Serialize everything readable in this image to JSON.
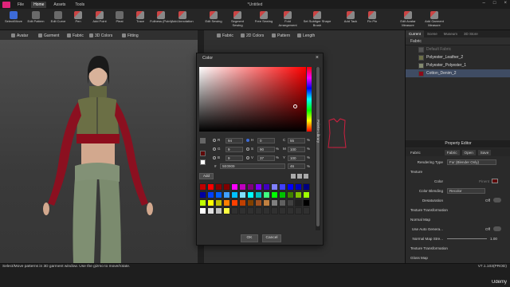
{
  "menubar": {
    "items": [
      "File",
      "Home",
      "Assets",
      "Tools"
    ],
    "title": "*Untitled"
  },
  "toolbar": {
    "tools": [
      "Select/Move",
      "Edit Pattern",
      "Edit Curve",
      "Pen",
      "Add Point",
      "Pleat",
      "Trace",
      "Fullness (Point)",
      "Add Annotation",
      "Edit Sewing",
      "Segment Sewing",
      "Free Sewing",
      "Fold Arrangement",
      "Set Subtiger Shape Brush",
      "Add Tack",
      "Fix Pin",
      "Edit Avatar Measure",
      "Add Garment Measure"
    ]
  },
  "view3d_tabs": [
    "Avatar",
    "Garment",
    "Fabric",
    "3D Colors",
    "Fitting"
  ],
  "view2d_tabs": [
    "Fabric",
    "2D Colors",
    "Pattern",
    "Length"
  ],
  "right_tabs": [
    "Current",
    "Scene",
    "Museum",
    "3D Store"
  ],
  "fabric_list": {
    "header": "Fabric",
    "items": [
      {
        "label": "Default Fabric",
        "color": "#555555",
        "state": "dim"
      },
      {
        "label": "Polyester_Leather_2",
        "color": "#6d7048",
        "state": "normal"
      },
      {
        "label": "Polyester_Polyester_1",
        "color": "#848b70",
        "state": "normal"
      },
      {
        "label": "Cotton_Denim_2",
        "color": "#8b0a1a",
        "state": "selected"
      }
    ]
  },
  "property_editor": {
    "title": "Property Editor",
    "header": "Fabric",
    "header_btns": [
      "Fabric",
      "Open",
      "Save"
    ],
    "rendering_type_label": "Rendering Type",
    "rendering_type_value": "Fur (Blender Only)",
    "texture_label": "Texture",
    "color_label": "Color",
    "color_value": "Pinent",
    "color_blending_label": "Color Blending",
    "color_blending_value": "Recolor",
    "desaturation_label": "Desaturation",
    "desaturation_value": "Off",
    "texture_transformation": "Texture Transformation",
    "normal_map_label": "Normal Map",
    "use_auto_label": "Use Auto Genera...",
    "use_auto_value": "Off",
    "normal_map_strength_label": "Normal Map Stre...",
    "normal_map_strength_value": "1.00",
    "texture_transformation2": "Texture Transformation",
    "gloss_map_label": "Gloss Map"
  },
  "color_dialog": {
    "title": "Color",
    "close": "×",
    "fields": {
      "R": "94",
      "G": "9",
      "B": "9",
      "H": "0",
      "S": "90",
      "V": "37",
      "C": "55",
      "M": "100",
      "Y": "100",
      "K": "46"
    },
    "percent": "%",
    "hash": "#",
    "hex": "5E0909",
    "add_label": "Add",
    "side_label": "Palette Library",
    "ok": "OK",
    "cancel": "Cancel",
    "current_color": "#5e0909",
    "palette": [
      "#c00000",
      "#ff0000",
      "#8b0000",
      "#800000",
      "#ff00ff",
      "#c000c0",
      "#800080",
      "#8000ff",
      "#4000c0",
      "#8080ff",
      "#4040ff",
      "#0000ff",
      "#0000c0",
      "#000080",
      "#0000a0",
      "#0040ff",
      "#0060ff",
      "#40a0ff",
      "#00c0ff",
      "#80e0ff",
      "#00ffff",
      "#00c0c0",
      "#40ff80",
      "#00ff00",
      "#00c000",
      "#408000",
      "#80c000",
      "#a0ff00",
      "#c0ff00",
      "#ffff00",
      "#c0c000",
      "#ff8000",
      "#ff4000",
      "#c04000",
      "#804000",
      "#a05020",
      "#c08040",
      "#808080",
      "#606060",
      "#404040",
      "#202020",
      "#000000",
      "#ffffff",
      "#e0e0e0",
      "#c0c0c0",
      "#ffff40",
      "#303030",
      "#303030",
      "#303030",
      "#303030",
      "#303030",
      "#303030",
      "#303030",
      "#303030",
      "#303030",
      "#303030"
    ]
  },
  "status": {
    "message": "Select/Move patterns in 3D garment window. Use the gizmo to move/rotate.",
    "version": "V7.1.103(PROD)",
    "watermark": "Udemy"
  },
  "colors": {
    "accent": "#3d6bd8",
    "brand": "#e0247a",
    "selected_row": "#3f4c63"
  }
}
